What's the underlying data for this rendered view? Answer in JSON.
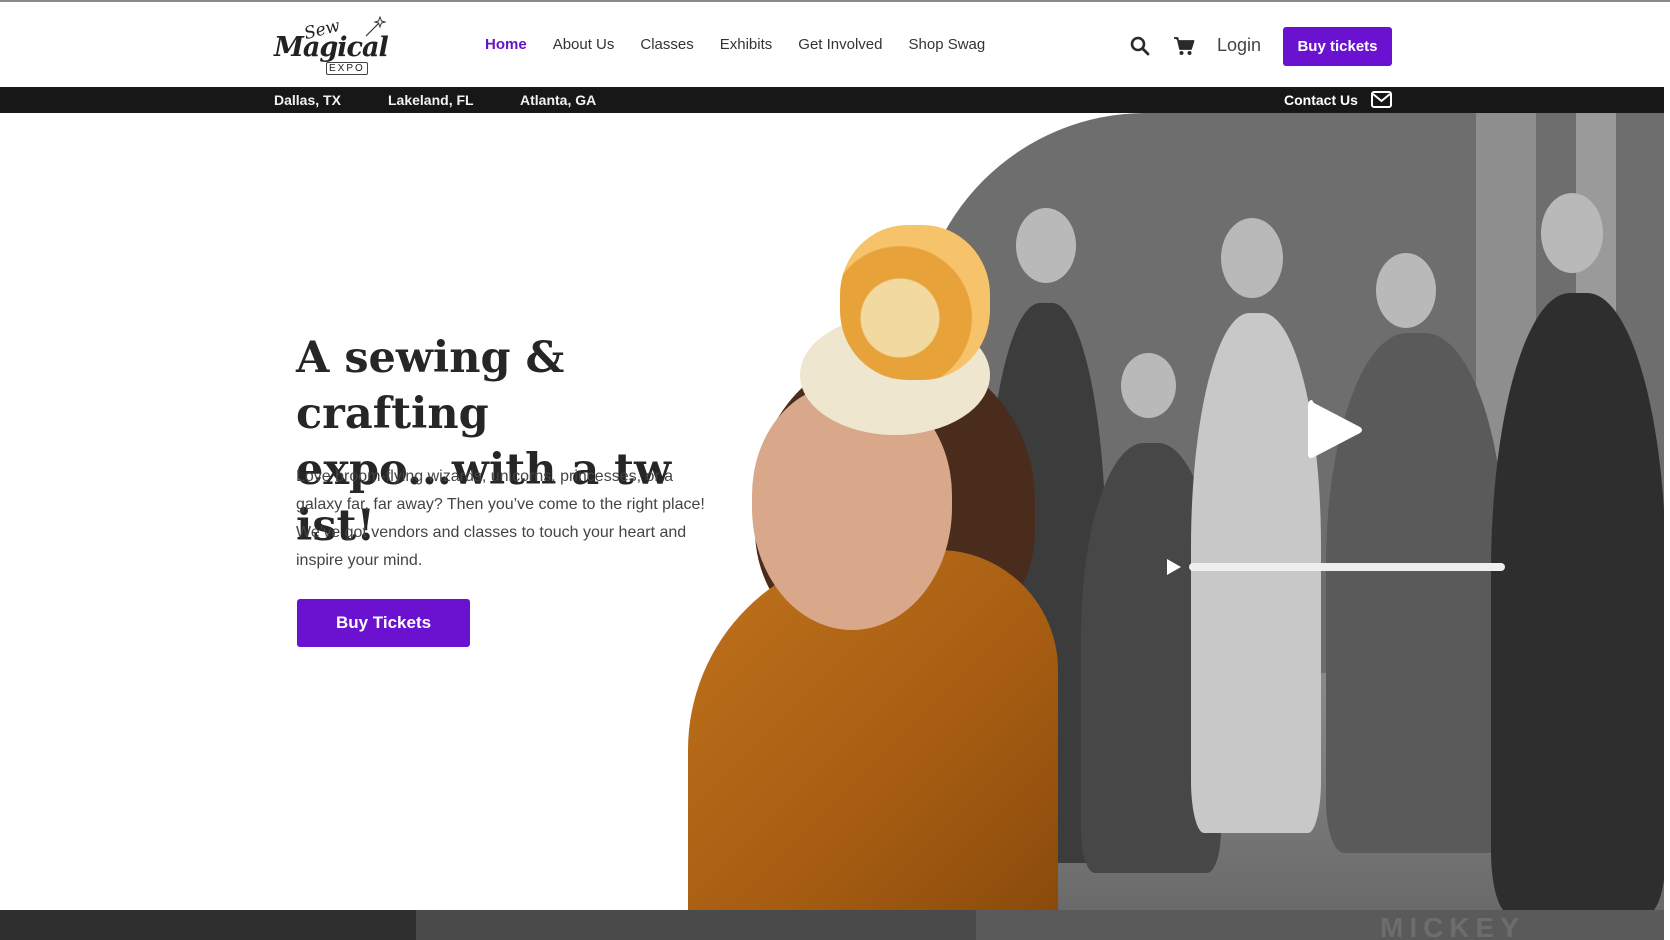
{
  "brand": {
    "logo_line1": "Sew",
    "logo_line2": "Magical",
    "logo_line3": "EXPO"
  },
  "nav": {
    "items": [
      {
        "label": "Home",
        "active": true
      },
      {
        "label": "About Us",
        "active": false
      },
      {
        "label": "Classes",
        "active": false
      },
      {
        "label": "Exhibits",
        "active": false
      },
      {
        "label": "Get Involved",
        "active": false
      },
      {
        "label": "Shop Swag",
        "active": false
      }
    ],
    "search_icon": "search-icon",
    "cart_icon": "cart-icon",
    "login_label": "Login",
    "buy_label": "Buy tickets"
  },
  "locations": {
    "items": [
      "Dallas, TX",
      "Lakeland, FL",
      "Atlanta, GA"
    ],
    "contact_label": "Contact Us",
    "contact_icon": "mail-icon"
  },
  "hero": {
    "headline": "A sewing & crafting expo...with a tw ist!",
    "lead": "Love broom-flying wizards, unicorns, princesses, or a galaxy far, far away? Then you’ve come to the right place! We’ve got vendors and classes to touch your heart and inspire your mind.",
    "cta_label": "Buy Tickets",
    "video": {
      "play_icon": "play-icon",
      "progress": 0.0
    }
  },
  "footer_strip": {
    "partial_text": "MICKEY"
  },
  "colors": {
    "accent": "#6a12d0",
    "nav_active": "#6a12c9",
    "bar_bg": "#171717"
  }
}
